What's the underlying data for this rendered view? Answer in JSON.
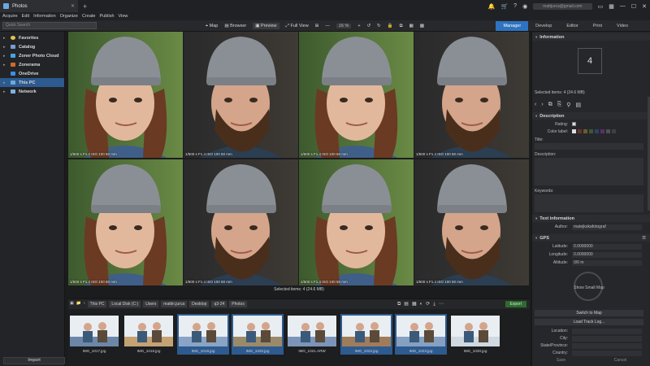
{
  "window": {
    "tab_title": "Photos"
  },
  "titlebar": {
    "account_email": "mattjurca@gmail.com"
  },
  "menu": [
    "Acquire",
    "Edit",
    "Information",
    "Organize",
    "Create",
    "Publish",
    "View"
  ],
  "toolbar": {
    "search_placeholder": "Quick Search",
    "map": "Map",
    "browser": "Browser",
    "preview": "Preview",
    "fullview": "Full View",
    "zoom_value": "16 %"
  },
  "modes": [
    {
      "label": "Manager",
      "active": true
    },
    {
      "label": "Develop",
      "active": false
    },
    {
      "label": "Editor",
      "active": false
    },
    {
      "label": "Print",
      "active": false
    },
    {
      "label": "Video",
      "active": false
    }
  ],
  "nav": [
    {
      "label": "Favorites",
      "color": "#e3c34a"
    },
    {
      "label": "Catalog",
      "color": "#7a9ccf"
    },
    {
      "label": "Zoner Photo Cloud",
      "color": "#4aa3df"
    },
    {
      "label": "Zonerama",
      "color": "#d06a2a"
    },
    {
      "label": "OneDrive",
      "color": "#3a8ee6"
    },
    {
      "label": "This PC",
      "color": "#6fa8dc",
      "selected": true
    },
    {
      "label": "Network",
      "color": "#7fb2e8"
    }
  ],
  "import_label": "Import",
  "grid": {
    "photo_meta": "1/500 s   F1.4   ISO 100   50 mm",
    "selected_items": "Selected items: 4 (24.6 MB)"
  },
  "breadcrumbs": [
    "This PC",
    "Local Disk (C:)",
    "Users",
    "mattin.jurca",
    "Desktop",
    "q3-24",
    "Photos"
  ],
  "export_label": "Export",
  "filmstrip": [
    {
      "label": "IMG_1017.jpg",
      "selected": false
    },
    {
      "label": "IMG_1018.jpg",
      "selected": false
    },
    {
      "label": "IMG_1019.jpg",
      "selected": true
    },
    {
      "label": "IMG_1020.jpg",
      "selected": true
    },
    {
      "label": "IMG_1021.ARW",
      "selected": false
    },
    {
      "label": "IMG_1022.jpg",
      "selected": true
    },
    {
      "label": "IMG_1023.jpg",
      "selected": true
    },
    {
      "label": "IMG_1030.jpg",
      "selected": false
    }
  ],
  "info": {
    "header": "Information",
    "count": "4",
    "selected": "Selected items: 4 (24.6 MB)",
    "description_header": "Description",
    "rating": "Rating:",
    "color_label": "Color label:",
    "title": "Title:",
    "description": "Description:",
    "keywords": "Keywords:",
    "text_info_header": "Text information",
    "author_key": "Author:",
    "author_val": "matejkokafotograf",
    "gps_header": "GPS",
    "latitude_key": "Latitude:",
    "latitude_val": "0.0000000",
    "longitude_key": "Longitude:",
    "longitude_val": "0.0000000",
    "altitude_key": "Altitude:",
    "altitude_val": "0/0 m",
    "show_small_map": "Show Small Map",
    "switch_to_map": "Switch to Map",
    "load_track_log": "Load Track Log...",
    "location": "Location:",
    "city": "City:",
    "state": "State/Province:",
    "country": "Country:",
    "save": "Save",
    "cancel": "Cancel"
  }
}
